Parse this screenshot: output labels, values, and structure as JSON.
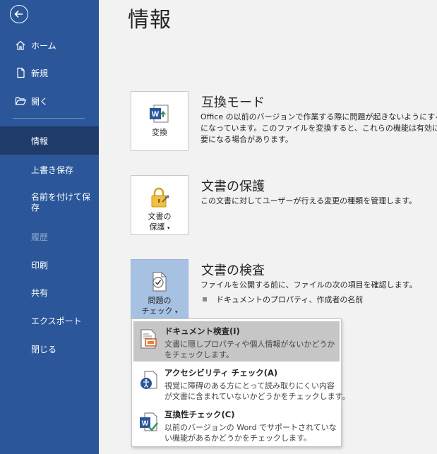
{
  "sidebar": {
    "back_icon": "back-arrow-icon",
    "items": [
      {
        "label": "ホーム",
        "icon": "home-icon"
      },
      {
        "label": "新規",
        "icon": "new-document-icon"
      },
      {
        "label": "開く",
        "icon": "open-folder-icon"
      },
      {
        "label": "情報"
      },
      {
        "label": "上書き保存"
      },
      {
        "label": "名前を付けて保存"
      },
      {
        "label": "履歴"
      },
      {
        "label": "印刷"
      },
      {
        "label": "共有"
      },
      {
        "label": "エクスポート"
      },
      {
        "label": "閉じる"
      }
    ],
    "active_item": "情報",
    "disabled_item": "履歴"
  },
  "main": {
    "title": "情報",
    "sections": [
      {
        "button_label": "変換",
        "title": "互換モード",
        "desc_lines": [
          "Office の以前のバージョンで作業する際に問題が起きないようにするため",
          "になっています。このファイルを変換すると、これらの機能は有効になります",
          "要になる場合があります。"
        ]
      },
      {
        "button_label_1": "文書の",
        "button_label_2": "保護",
        "title": "文書の保護",
        "desc_lines": [
          "この文書に対してユーザーが行える変更の種類を管理します。"
        ]
      },
      {
        "button_label_1": "問題の",
        "button_label_2": "チェック",
        "title": "文書の検査",
        "desc_lines": [
          "ファイルを公開する前に、ファイルの次の項目を確認します。"
        ],
        "bullet": "ドキュメントのプロパティ、作成者の名前"
      }
    ]
  },
  "menu": {
    "items": [
      {
        "title": "ドキュメント検査(I)",
        "desc_lines": [
          "文書に隠しプロパティや個人情報がないかどうか",
          "をチェックします。"
        ],
        "icon": "document-inspect-icon"
      },
      {
        "title": "アクセシビリティ チェック(A)",
        "desc_lines": [
          "視覚に障碍のある方にとって読み取りにくい内容",
          "が文書に含まれていないかどうかをチェックします。"
        ],
        "icon": "accessibility-check-icon"
      },
      {
        "title": "互換性チェック(C)",
        "desc_lines": [
          "以前のバージョンの Word でサポートされていな",
          "い機能があるかどうかをチェックします。"
        ],
        "icon": "compatibility-check-icon"
      }
    ]
  },
  "colors": {
    "sidebar": "#2b579a",
    "sidebar_active": "#1f3b6a",
    "background": "#f2f2f2",
    "pressed_tile": "#a7c1e3",
    "menu_hover": "#c6c6c6"
  }
}
